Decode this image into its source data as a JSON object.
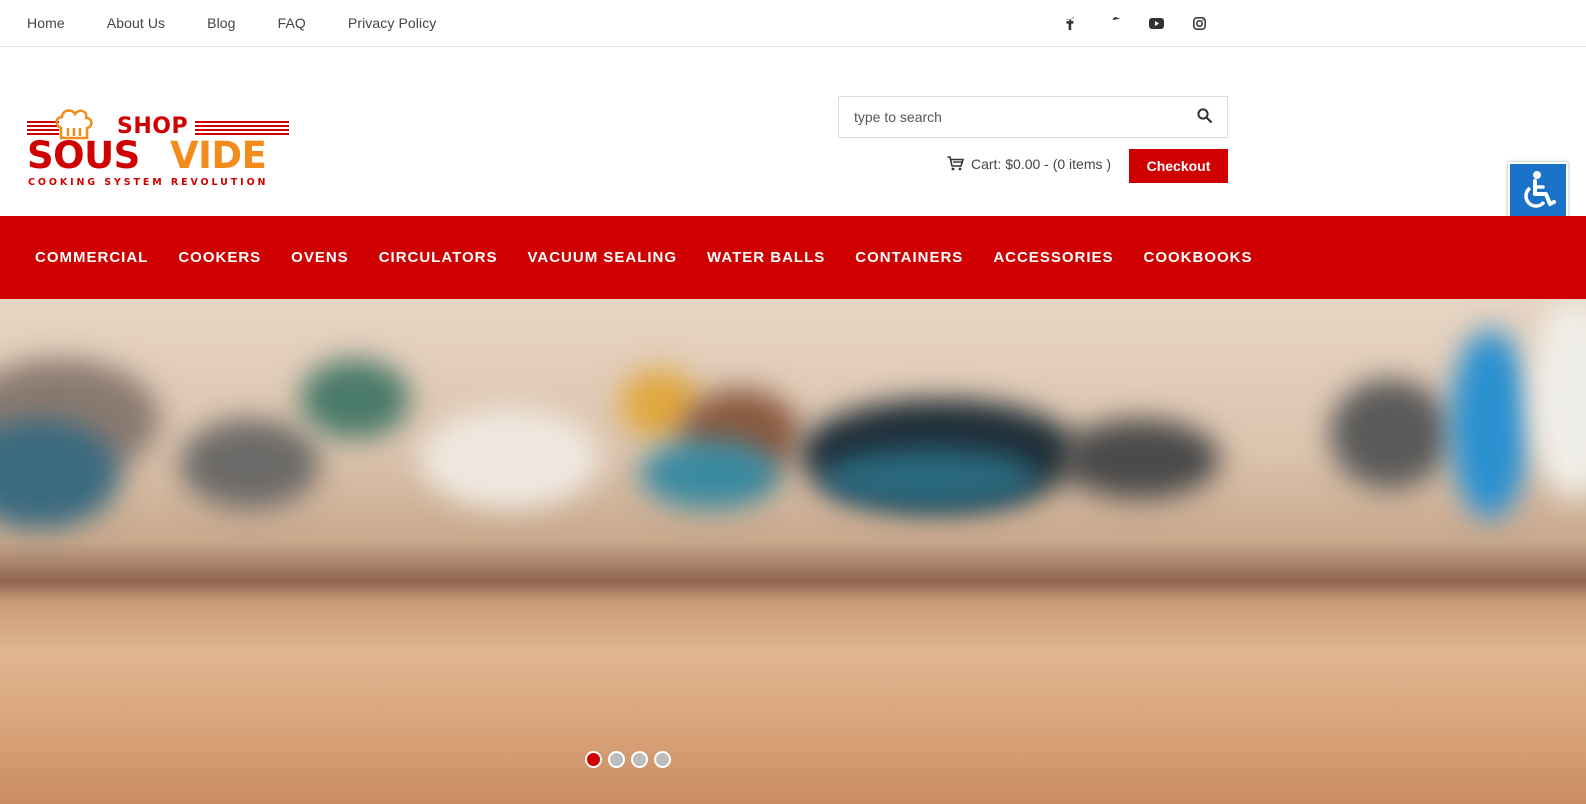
{
  "top_nav": {
    "links": [
      "Home",
      "About Us",
      "Blog",
      "FAQ",
      "Privacy Policy"
    ]
  },
  "social": {
    "icons": [
      "facebook-icon",
      "twitter-icon",
      "youtube-icon",
      "instagram-icon"
    ]
  },
  "logo": {
    "line1": "SHOP",
    "word1": "SOUS",
    "word2": "VIDE",
    "tagline": "COOKING SYSTEM REVOLUTION"
  },
  "search": {
    "placeholder": "type to search"
  },
  "cart": {
    "text": "Cart: $0.00 - (0 items )"
  },
  "checkout": {
    "label": "Checkout"
  },
  "main_nav": {
    "items": [
      "COMMERCIAL",
      "COOKERS",
      "OVENS",
      "CIRCULATORS",
      "VACUUM SEALING",
      "WATER BALLS",
      "CONTAINERS",
      "ACCESSORIES",
      "COOKBOOKS"
    ]
  },
  "slider": {
    "slide_count": 4,
    "active_index": 0
  },
  "colors": {
    "brand_red": "#d10000",
    "logo_orange": "#f28c1c",
    "accessibility_blue": "#1a73c9"
  }
}
